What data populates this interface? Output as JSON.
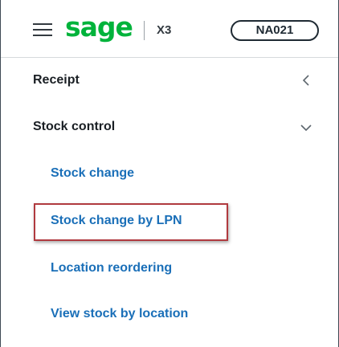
{
  "header": {
    "brand": "sage",
    "product": "X3",
    "folder": "NA021"
  },
  "nav": {
    "receipt": {
      "label": "Receipt",
      "state": "collapsed"
    },
    "stock_control": {
      "label": "Stock control",
      "state": "expanded",
      "items": [
        {
          "label": "Stock change"
        },
        {
          "label": "Stock change by LPN"
        },
        {
          "label": "Location reordering"
        },
        {
          "label": "View stock by location"
        }
      ]
    }
  },
  "colors": {
    "brand": "#00b33b",
    "link": "#1a6fb8",
    "highlight": "#b03a3f"
  },
  "icons": {
    "menu": "hamburger-menu-icon",
    "collapsed": "chevron-left-icon",
    "expanded": "chevron-down-icon"
  }
}
